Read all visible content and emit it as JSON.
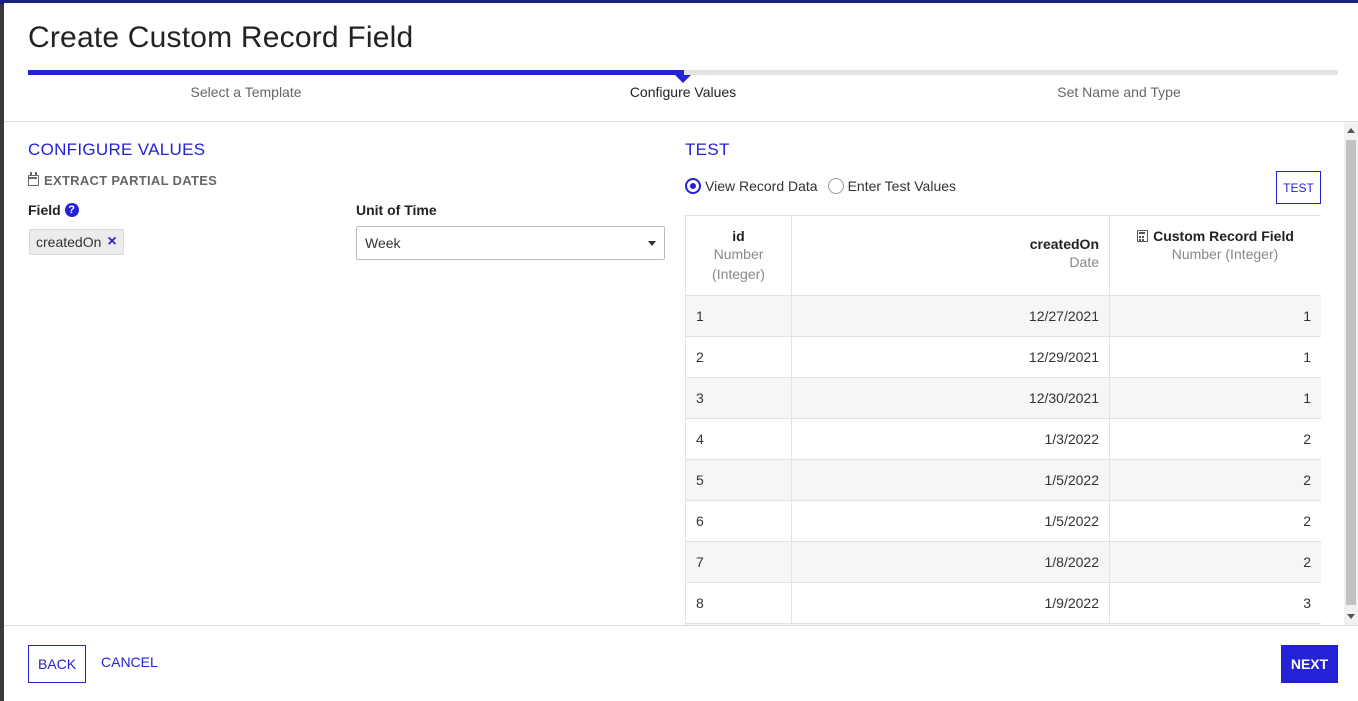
{
  "dialog": {
    "title": "Create Custom Record Field"
  },
  "stepper": {
    "steps": [
      {
        "label": "Select a Template"
      },
      {
        "label": "Configure Values"
      },
      {
        "label": "Set Name and Type"
      }
    ],
    "active_index": 1
  },
  "configure": {
    "title": "CONFIGURE VALUES",
    "subtitle": "EXTRACT PARTIAL DATES",
    "field_label": "Field",
    "field_value": "createdOn",
    "unit_label": "Unit of Time",
    "unit_value": "Week"
  },
  "test": {
    "title": "TEST",
    "option_view": "View Record Data",
    "option_enter": "Enter Test Values",
    "selected_option": "View Record Data",
    "button_label": "TEST",
    "columns": [
      {
        "name": "id",
        "type": "Number (Integer)"
      },
      {
        "name": "createdOn",
        "type": "Date"
      },
      {
        "name": "Custom Record Field",
        "type": "Number (Integer)"
      }
    ],
    "rows": [
      [
        "1",
        "12/27/2021",
        "1"
      ],
      [
        "2",
        "12/29/2021",
        "1"
      ],
      [
        "3",
        "12/30/2021",
        "1"
      ],
      [
        "4",
        "1/3/2022",
        "2"
      ],
      [
        "5",
        "1/5/2022",
        "2"
      ],
      [
        "6",
        "1/5/2022",
        "2"
      ],
      [
        "7",
        "1/8/2022",
        "2"
      ],
      [
        "8",
        "1/9/2022",
        "3"
      ],
      [
        "",
        "",
        ""
      ]
    ]
  },
  "footer": {
    "back_label": "BACK",
    "cancel_label": "CANCEL",
    "next_label": "NEXT"
  },
  "colors": {
    "accent": "#2322d6"
  },
  "icons": [
    "calendar-icon",
    "help-icon",
    "remove-icon",
    "chevron-down-icon",
    "calculator-icon"
  ]
}
